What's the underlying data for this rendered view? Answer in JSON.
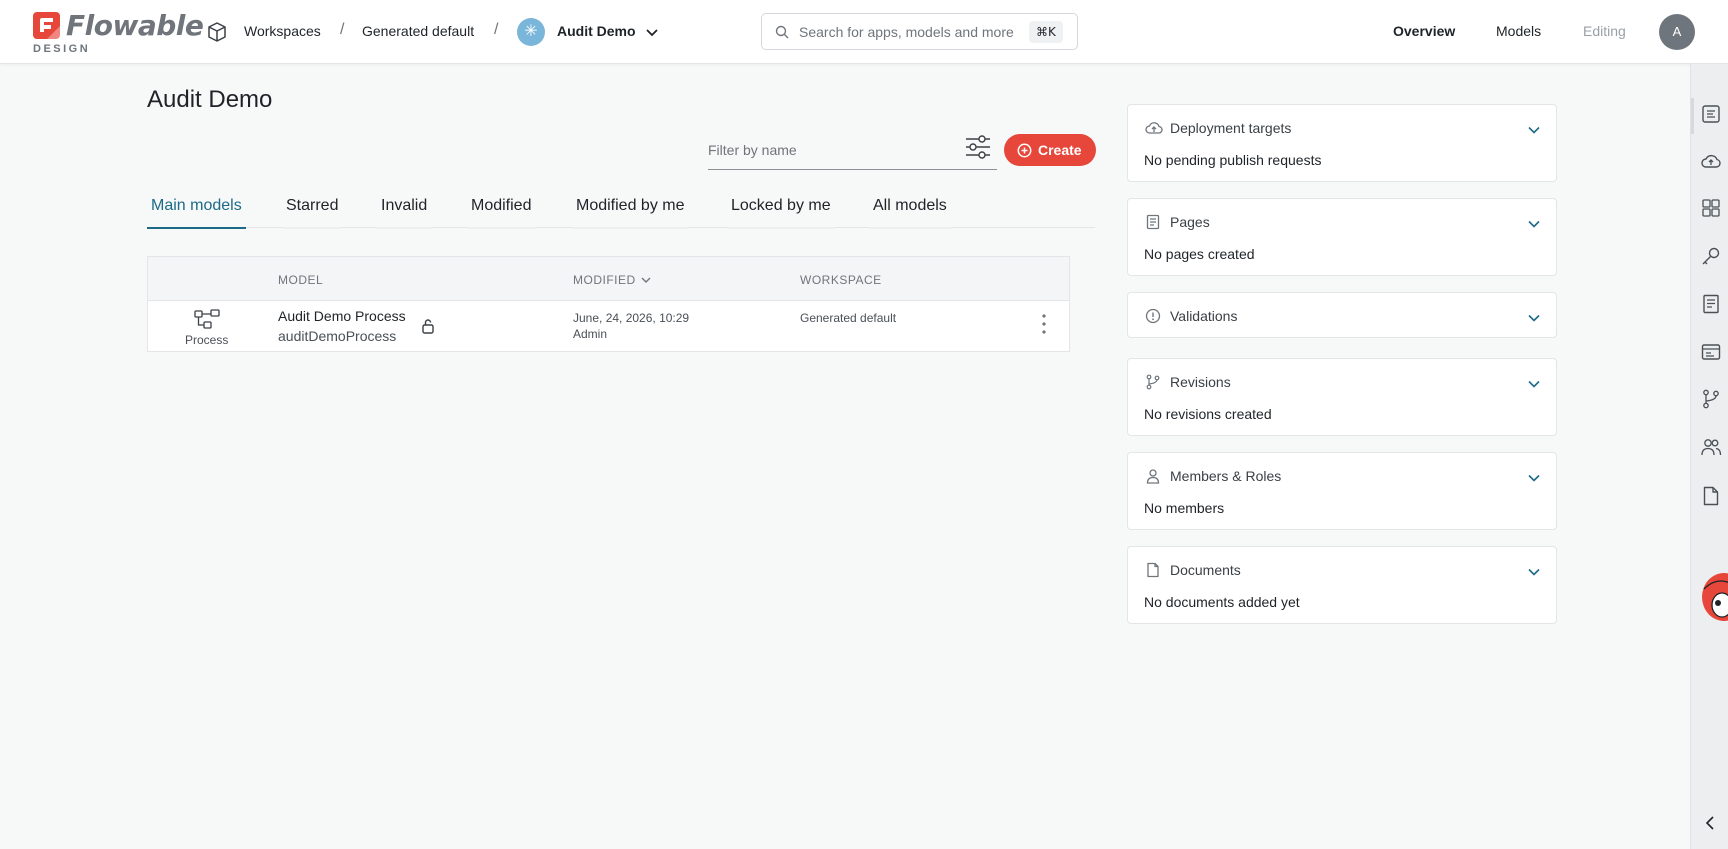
{
  "header": {
    "logo_text": "Flowable",
    "logo_sub": "DESIGN",
    "breadcrumbs": [
      "Workspaces",
      "Generated default"
    ],
    "separator": "/",
    "app_avatar_glyph": "✳",
    "app_name": "Audit Demo",
    "search_placeholder": "Search for apps, models and more",
    "search_shortcut": "⌘K",
    "nav": {
      "overview": "Overview",
      "models": "Models",
      "editing": "Editing"
    },
    "user_initial": "A"
  },
  "main": {
    "title": "Audit Demo",
    "filter_placeholder": "Filter by name",
    "create_label": "Create",
    "tabs": [
      "Main models",
      "Starred",
      "Invalid",
      "Modified",
      "Modified by me",
      "Locked by me",
      "All models"
    ],
    "active_tab": "Main models",
    "table": {
      "headers": {
        "model": "MODEL",
        "modified": "MODIFIED",
        "workspace": "WORKSPACE"
      },
      "rows": [
        {
          "type": "Process",
          "name": "Audit Demo Process",
          "key": "auditDemoProcess",
          "modified_date": "June, 24, 2026, 10:29",
          "modified_by": "Admin",
          "workspace": "Generated default"
        }
      ]
    }
  },
  "panels": [
    {
      "title": "Deployment targets",
      "body": "No pending publish requests",
      "icon": "cloud-upload-icon"
    },
    {
      "title": "Pages",
      "body": "No pages created",
      "icon": "page-icon"
    },
    {
      "title": "Validations",
      "body": "",
      "icon": "alert-circle-icon"
    },
    {
      "title": "Revisions",
      "body": "No revisions created",
      "icon": "branch-icon"
    },
    {
      "title": "Members & Roles",
      "body": "No members",
      "icon": "user-icon"
    },
    {
      "title": "Documents",
      "body": "No documents added yet",
      "icon": "document-icon"
    }
  ],
  "colors": {
    "accent": "#e6473a",
    "active_tab": "#1c6a86"
  }
}
